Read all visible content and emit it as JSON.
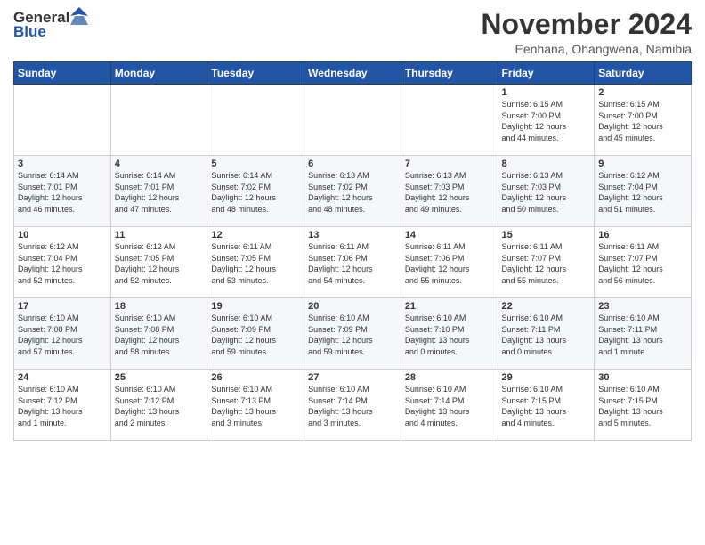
{
  "logo": {
    "general": "General",
    "blue": "Blue"
  },
  "title": "November 2024",
  "subtitle": "Eenhana, Ohangwena, Namibia",
  "days_header": [
    "Sunday",
    "Monday",
    "Tuesday",
    "Wednesday",
    "Thursday",
    "Friday",
    "Saturday"
  ],
  "weeks": [
    [
      {
        "day": "",
        "info": ""
      },
      {
        "day": "",
        "info": ""
      },
      {
        "day": "",
        "info": ""
      },
      {
        "day": "",
        "info": ""
      },
      {
        "day": "",
        "info": ""
      },
      {
        "day": "1",
        "info": "Sunrise: 6:15 AM\nSunset: 7:00 PM\nDaylight: 12 hours\nand 44 minutes."
      },
      {
        "day": "2",
        "info": "Sunrise: 6:15 AM\nSunset: 7:00 PM\nDaylight: 12 hours\nand 45 minutes."
      }
    ],
    [
      {
        "day": "3",
        "info": "Sunrise: 6:14 AM\nSunset: 7:01 PM\nDaylight: 12 hours\nand 46 minutes."
      },
      {
        "day": "4",
        "info": "Sunrise: 6:14 AM\nSunset: 7:01 PM\nDaylight: 12 hours\nand 47 minutes."
      },
      {
        "day": "5",
        "info": "Sunrise: 6:14 AM\nSunset: 7:02 PM\nDaylight: 12 hours\nand 48 minutes."
      },
      {
        "day": "6",
        "info": "Sunrise: 6:13 AM\nSunset: 7:02 PM\nDaylight: 12 hours\nand 48 minutes."
      },
      {
        "day": "7",
        "info": "Sunrise: 6:13 AM\nSunset: 7:03 PM\nDaylight: 12 hours\nand 49 minutes."
      },
      {
        "day": "8",
        "info": "Sunrise: 6:13 AM\nSunset: 7:03 PM\nDaylight: 12 hours\nand 50 minutes."
      },
      {
        "day": "9",
        "info": "Sunrise: 6:12 AM\nSunset: 7:04 PM\nDaylight: 12 hours\nand 51 minutes."
      }
    ],
    [
      {
        "day": "10",
        "info": "Sunrise: 6:12 AM\nSunset: 7:04 PM\nDaylight: 12 hours\nand 52 minutes."
      },
      {
        "day": "11",
        "info": "Sunrise: 6:12 AM\nSunset: 7:05 PM\nDaylight: 12 hours\nand 52 minutes."
      },
      {
        "day": "12",
        "info": "Sunrise: 6:11 AM\nSunset: 7:05 PM\nDaylight: 12 hours\nand 53 minutes."
      },
      {
        "day": "13",
        "info": "Sunrise: 6:11 AM\nSunset: 7:06 PM\nDaylight: 12 hours\nand 54 minutes."
      },
      {
        "day": "14",
        "info": "Sunrise: 6:11 AM\nSunset: 7:06 PM\nDaylight: 12 hours\nand 55 minutes."
      },
      {
        "day": "15",
        "info": "Sunrise: 6:11 AM\nSunset: 7:07 PM\nDaylight: 12 hours\nand 55 minutes."
      },
      {
        "day": "16",
        "info": "Sunrise: 6:11 AM\nSunset: 7:07 PM\nDaylight: 12 hours\nand 56 minutes."
      }
    ],
    [
      {
        "day": "17",
        "info": "Sunrise: 6:10 AM\nSunset: 7:08 PM\nDaylight: 12 hours\nand 57 minutes."
      },
      {
        "day": "18",
        "info": "Sunrise: 6:10 AM\nSunset: 7:08 PM\nDaylight: 12 hours\nand 58 minutes."
      },
      {
        "day": "19",
        "info": "Sunrise: 6:10 AM\nSunset: 7:09 PM\nDaylight: 12 hours\nand 59 minutes."
      },
      {
        "day": "20",
        "info": "Sunrise: 6:10 AM\nSunset: 7:09 PM\nDaylight: 12 hours\nand 59 minutes."
      },
      {
        "day": "21",
        "info": "Sunrise: 6:10 AM\nSunset: 7:10 PM\nDaylight: 13 hours\nand 0 minutes."
      },
      {
        "day": "22",
        "info": "Sunrise: 6:10 AM\nSunset: 7:11 PM\nDaylight: 13 hours\nand 0 minutes."
      },
      {
        "day": "23",
        "info": "Sunrise: 6:10 AM\nSunset: 7:11 PM\nDaylight: 13 hours\nand 1 minute."
      }
    ],
    [
      {
        "day": "24",
        "info": "Sunrise: 6:10 AM\nSunset: 7:12 PM\nDaylight: 13 hours\nand 1 minute."
      },
      {
        "day": "25",
        "info": "Sunrise: 6:10 AM\nSunset: 7:12 PM\nDaylight: 13 hours\nand 2 minutes."
      },
      {
        "day": "26",
        "info": "Sunrise: 6:10 AM\nSunset: 7:13 PM\nDaylight: 13 hours\nand 3 minutes."
      },
      {
        "day": "27",
        "info": "Sunrise: 6:10 AM\nSunset: 7:14 PM\nDaylight: 13 hours\nand 3 minutes."
      },
      {
        "day": "28",
        "info": "Sunrise: 6:10 AM\nSunset: 7:14 PM\nDaylight: 13 hours\nand 4 minutes."
      },
      {
        "day": "29",
        "info": "Sunrise: 6:10 AM\nSunset: 7:15 PM\nDaylight: 13 hours\nand 4 minutes."
      },
      {
        "day": "30",
        "info": "Sunrise: 6:10 AM\nSunset: 7:15 PM\nDaylight: 13 hours\nand 5 minutes."
      }
    ]
  ]
}
